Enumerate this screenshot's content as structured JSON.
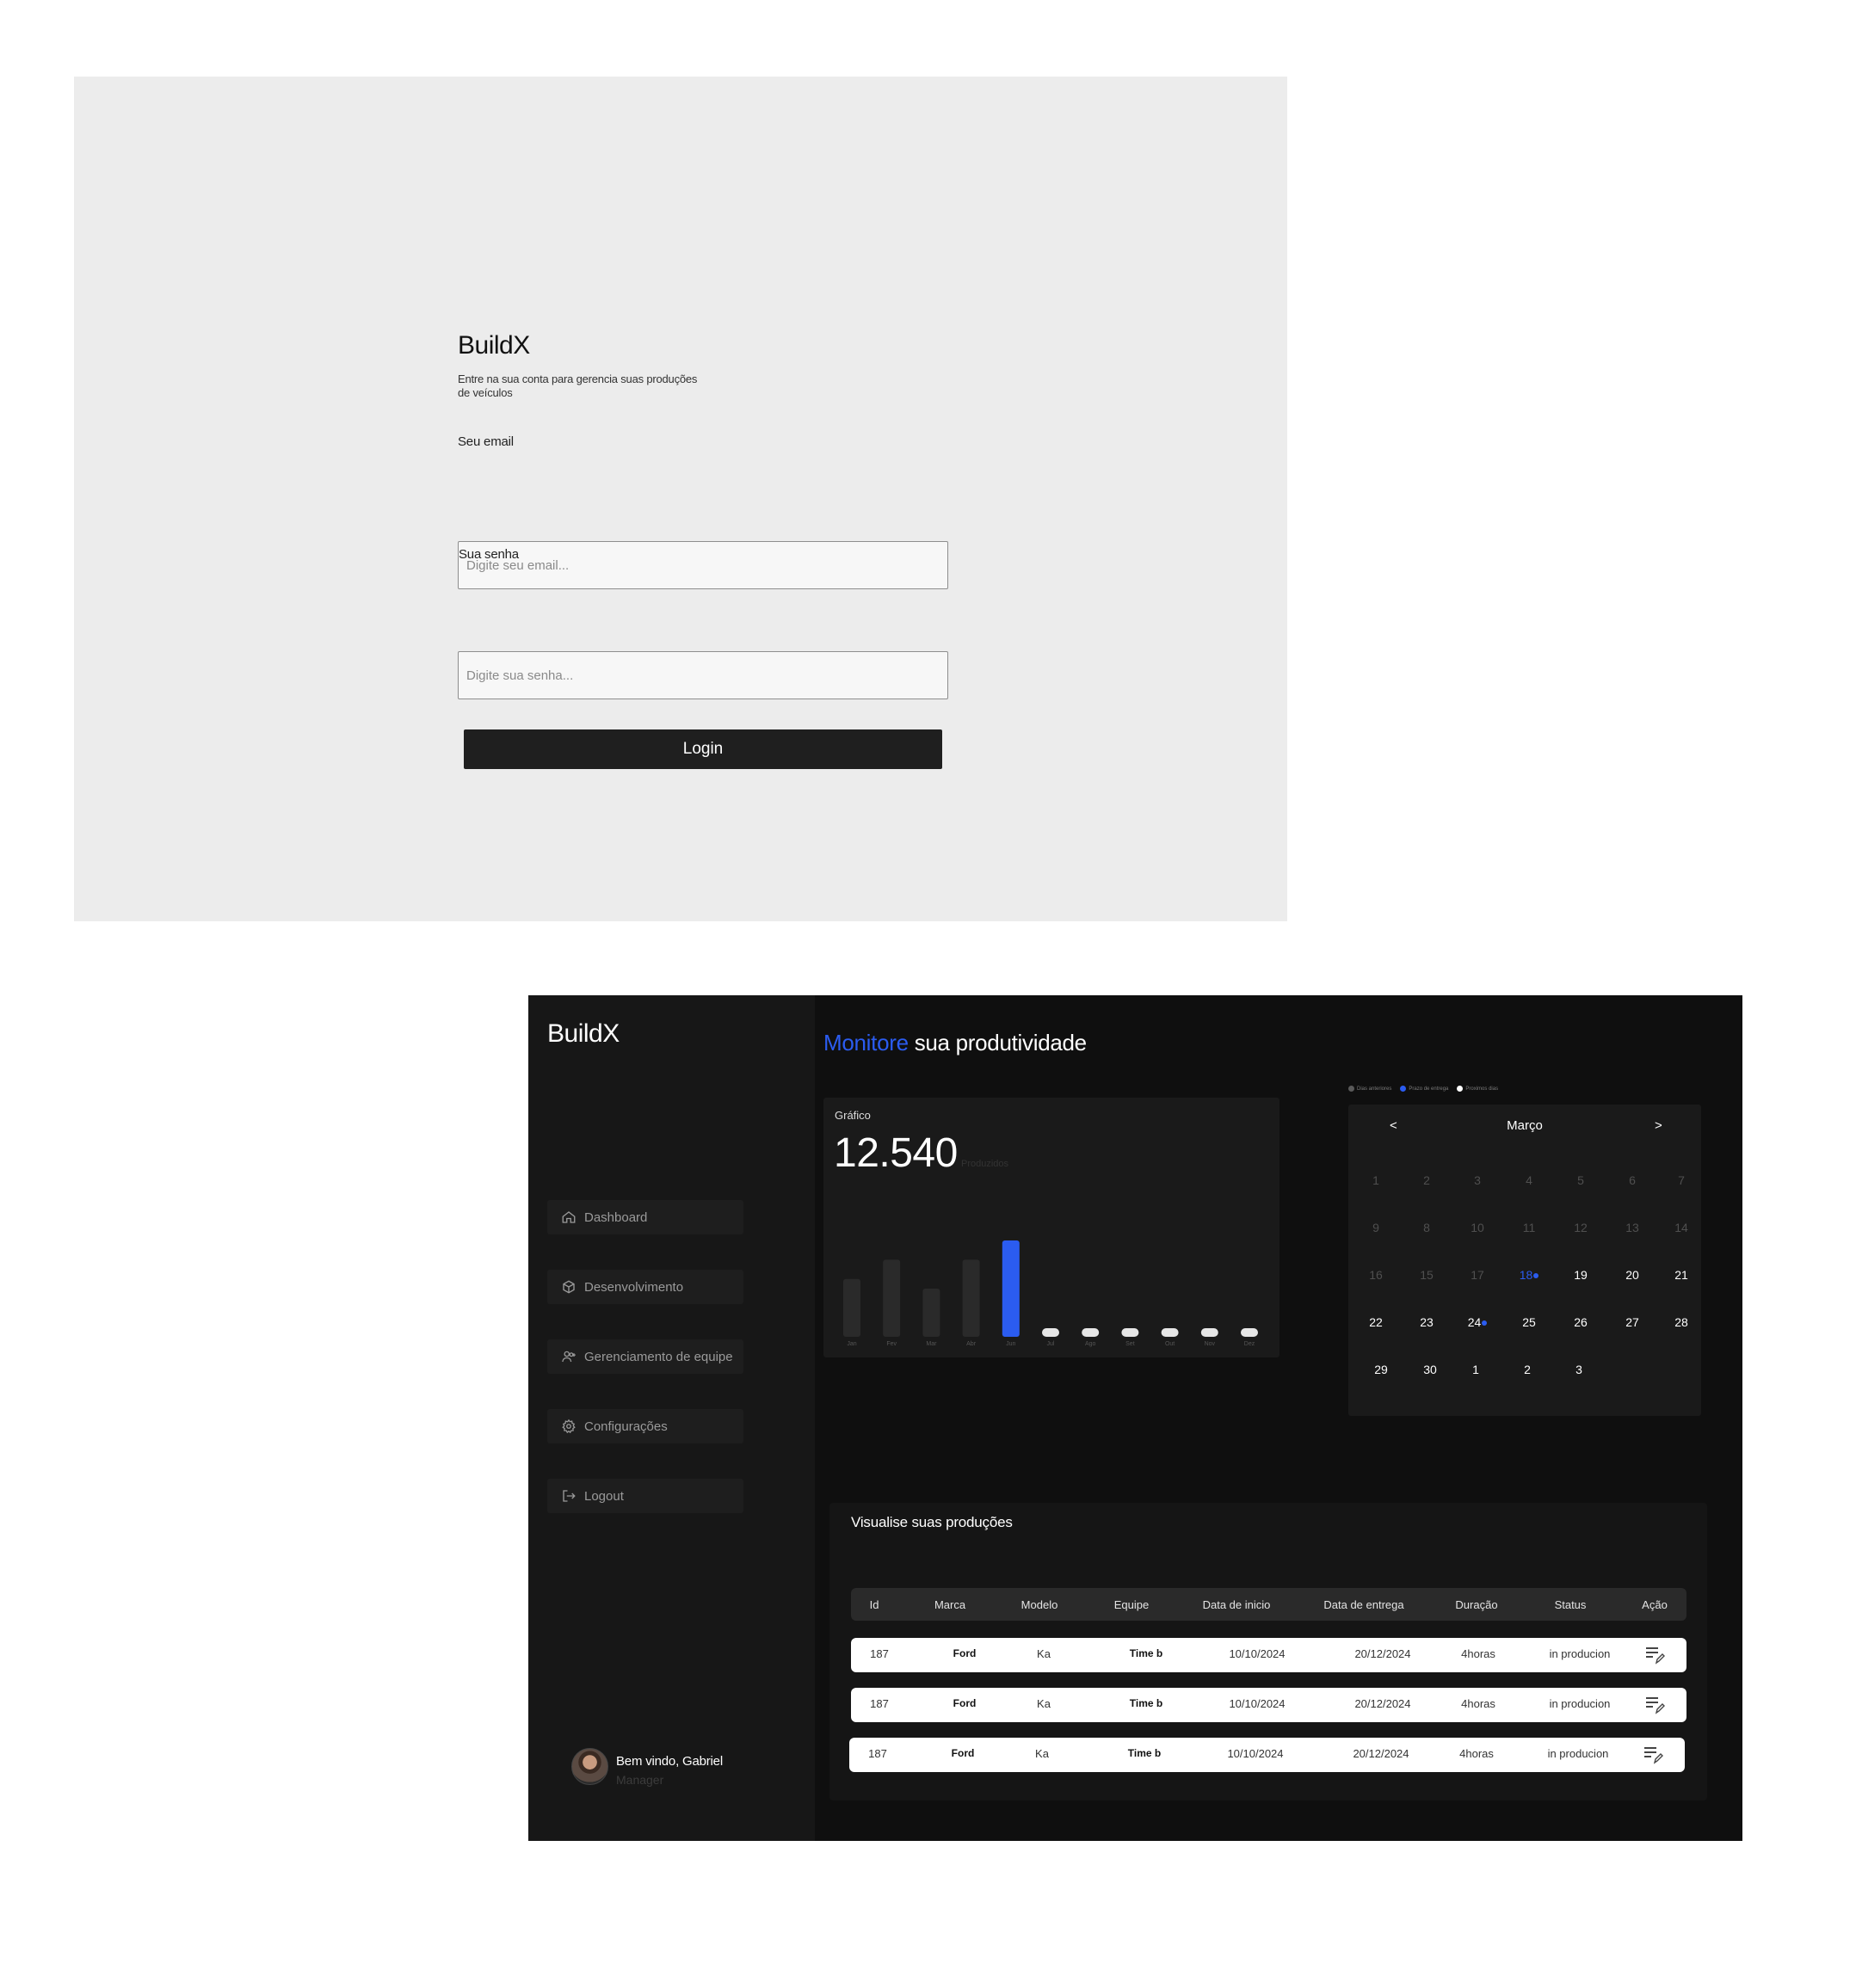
{
  "login": {
    "logo": "BuildX",
    "subtitle": "Entre na sua conta para gerencia suas produções de veículos",
    "email_label": "Seu email",
    "email_placeholder": "Digite seu email...",
    "password_label": "Sua senha",
    "password_placeholder": "Digite sua senha...",
    "button_label": "Login"
  },
  "dashboard": {
    "logo": "BuildX",
    "headline_accent": "Monitore",
    "headline_rest": " sua produtividade",
    "sidebar": {
      "items": [
        {
          "label": "Dashboard",
          "icon": "home-icon"
        },
        {
          "label": "Desenvolvimento",
          "icon": "cube-icon"
        },
        {
          "label": "Gerenciamento de equipe",
          "icon": "user-add-icon"
        },
        {
          "label": "Configurações",
          "icon": "gear-icon"
        },
        {
          "label": "Logout",
          "icon": "logout-icon"
        }
      ],
      "user": {
        "name": "Bem vindo, Gabriel",
        "role": "Manager"
      }
    },
    "chart_card": {
      "title": "Gráfico",
      "total": "12.540",
      "unit": "Produzidos"
    },
    "calendar": {
      "legend": [
        {
          "label": "Dias anteriores",
          "color": "#5a5a5a"
        },
        {
          "label": "Prazo de entrega",
          "color": "#2b5cf0"
        },
        {
          "label": "Proximos dias",
          "color": "#ffffff"
        }
      ],
      "prev": "<",
      "next": ">",
      "month": "Março",
      "weeks": [
        [
          {
            "d": "1",
            "s": "past"
          },
          {
            "d": "2",
            "s": "past"
          },
          {
            "d": "3",
            "s": "past"
          },
          {
            "d": "4",
            "s": "past"
          },
          {
            "d": "5",
            "s": "past"
          },
          {
            "d": "6",
            "s": "past"
          },
          {
            "d": "7",
            "s": "past"
          }
        ],
        [
          {
            "d": "9",
            "s": "past"
          },
          {
            "d": "8",
            "s": "past"
          },
          {
            "d": "10",
            "s": "past"
          },
          {
            "d": "11",
            "s": "past"
          },
          {
            "d": "12",
            "s": "past"
          },
          {
            "d": "13",
            "s": "past"
          },
          {
            "d": "14",
            "s": "past"
          }
        ],
        [
          {
            "d": "16",
            "s": "past"
          },
          {
            "d": "15",
            "s": "past"
          },
          {
            "d": "17",
            "s": "past"
          },
          {
            "d": "18",
            "s": "deadline",
            "mark": true
          },
          {
            "d": "19",
            "s": "future"
          },
          {
            "d": "20",
            "s": "future"
          },
          {
            "d": "21",
            "s": "future"
          }
        ],
        [
          {
            "d": "22",
            "s": "future"
          },
          {
            "d": "23",
            "s": "future"
          },
          {
            "d": "24",
            "s": "future",
            "mark": true
          },
          {
            "d": "25",
            "s": "future"
          },
          {
            "d": "26",
            "s": "future"
          },
          {
            "d": "27",
            "s": "future"
          },
          {
            "d": "28",
            "s": "future"
          }
        ],
        [
          {
            "d": "29",
            "s": "future"
          },
          {
            "d": "30",
            "s": "future"
          },
          {
            "d": "1",
            "s": "future"
          },
          {
            "d": "2",
            "s": "future"
          },
          {
            "d": "3",
            "s": "future"
          }
        ]
      ]
    },
    "productions": {
      "title": "Visualise suas  produções",
      "columns": [
        "Id",
        "Marca",
        "Modelo",
        "Equipe",
        "Data de inicio",
        "Data de entrega",
        "Duração",
        "Status",
        "Ação"
      ],
      "rows": [
        [
          "187",
          "Ford",
          "Ka",
          "Time b",
          "10/10/2024",
          "20/12/2024",
          "4horas",
          "in producion"
        ],
        [
          "187",
          "Ford",
          "Ka",
          "Time b",
          "10/10/2024",
          "20/12/2024",
          "4horas",
          "in producion"
        ],
        [
          "187",
          "Ford",
          "Ka",
          "Time b",
          "10/10/2024",
          "20/12/2024",
          "4horas",
          "in producion"
        ]
      ],
      "action_icon": "edit-list-icon"
    }
  },
  "chart_data": {
    "type": "bar",
    "categories": [
      "Jan",
      "Fev",
      "Mar",
      "Abr",
      "Jun",
      "Jul",
      "Ago",
      "Set",
      "Out",
      "Nov",
      "Dez"
    ],
    "values": [
      60,
      80,
      50,
      80,
      100,
      0,
      0,
      0,
      0,
      0,
      0
    ],
    "highlight_index": 4,
    "colors": {
      "bar": "#2a2a2a",
      "highlight": "#2b5cf0",
      "empty": "#e6e6e6"
    },
    "ylim": [
      0,
      100
    ],
    "grid": false
  }
}
